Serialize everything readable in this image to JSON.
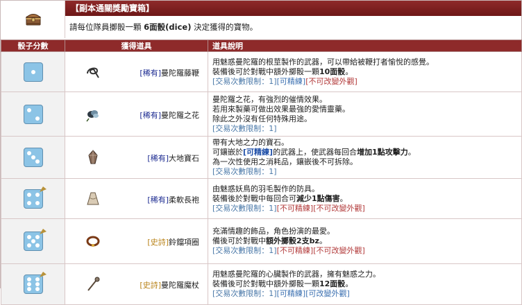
{
  "header": {
    "title": "【副本通關獎勵寶箱】",
    "intro_before": "請每位隊員擲骰一顆 ",
    "intro_bold": "6面骰(dice)",
    "intro_after": " 決定獲得的寶物。"
  },
  "columns": {
    "score": "骰子分數",
    "item": "獲得道具",
    "desc": "道具說明"
  },
  "icons": {
    "chest": "treasure-chest-icon",
    "die": "die-icon"
  },
  "colors": {
    "header_bg": "#8e2a2a",
    "rare": "#1b2a90",
    "epic": "#b88217",
    "die": "#8cc4e6"
  },
  "rows": [
    {
      "score": 1,
      "rarity": "[稀有]",
      "name": "曼陀羅藤鞭",
      "icon": "whip-icon",
      "lines": {
        "l1": "用魅惑曼陀羅的根莖製作的武器，可以帶給被鞭打者愉悅的感覺。",
        "l2a": "裝備後可於對戰中額外擲骰一顆",
        "l2b": "10面骰",
        "l2c": "。"
      },
      "limits": {
        "trade": "[交易次數限制：1]",
        "refine": "[可精練]",
        "change": "[不可改變外觀]"
      }
    },
    {
      "score": 2,
      "rarity": "[稀有]",
      "name": "曼陀羅之花",
      "icon": "flower-icon",
      "lines": {
        "l1": "曼陀羅之花，有強烈的催情效果。",
        "l2": "若用來製藥可做出效果最強的愛情靈藥。",
        "l3": "除此之外沒有任何特殊用途。"
      },
      "limits": {
        "trade": "[交易次數限制：1]"
      }
    },
    {
      "score": 3,
      "rarity": "[稀有]",
      "name": "大地寶石",
      "icon": "gem-icon",
      "lines": {
        "l1": "帶有大地之力的寶石。",
        "l2a": "可鑲嵌於",
        "l2b": "[可精練]",
        "l2c": "的武器上，使武器每回合",
        "l2d": "增加1點攻擊力",
        "l2e": "。",
        "l3": "為一次性使用之消耗品，鑲嵌後不可拆除。"
      },
      "limits": {
        "trade": "[交易次數限制：1]"
      }
    },
    {
      "score": 4,
      "rarity": "[稀有]",
      "name": "柔軟長袍",
      "icon": "robe-icon",
      "lines": {
        "l1": "由魅惑妖鳥的羽毛製作的防具。",
        "l2a": "裝備後於對戰中每回合可",
        "l2b": "減少1點傷害",
        "l2c": "。"
      },
      "limits": {
        "trade": "[交易次數限制：1]",
        "refine": "[不可精練]",
        "change": "[不可改變外觀]"
      }
    },
    {
      "score": 5,
      "rarity": "[史詩]",
      "name": "鈴鐺項圈",
      "icon": "collar-icon",
      "lines": {
        "l1": "充滿情趣的飾品，角色扮演的最愛。",
        "l2a": "備後可於對戰中",
        "l2b": "額外擲骰2支bz",
        "l2c": "。"
      },
      "limits": {
        "trade": "[交易次數限制：1]",
        "refine": "[不可精練]",
        "change": "[不可改變外觀]"
      }
    },
    {
      "score": 6,
      "rarity": "[史詩]",
      "name": "曼陀羅魔杖",
      "icon": "staff-icon",
      "lines": {
        "l1": "用魅惑曼陀羅的心臟製作的武器，擁有魅惑之力。",
        "l2a": "裝備後可於對戰中額外擲骰一顆",
        "l2b": "12面骰",
        "l2c": "。"
      },
      "limits": {
        "trade": "[交易次數限制：1]",
        "refine": "[可精練]",
        "change": "[可改變外觀]"
      }
    }
  ]
}
